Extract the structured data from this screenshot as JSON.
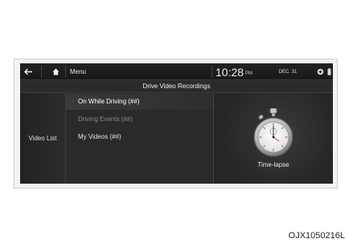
{
  "topbar": {
    "back_icon": "back-arrow-icon",
    "home_icon": "home-icon",
    "menu_label": "Menu",
    "time": "10:28",
    "ampm": "PM",
    "date": "DEC. 31",
    "status_icons": [
      "connectivity-status-icon",
      "battery-status-icon"
    ]
  },
  "header": {
    "title": "Drive Video Recordings"
  },
  "sidebar": {
    "label": "Video List"
  },
  "list": {
    "items": [
      {
        "label": "On While Driving (##)",
        "state": "selected"
      },
      {
        "label": "Driving Events (##)",
        "state": "disabled"
      },
      {
        "label": "My Videos (##)",
        "state": "enabled"
      }
    ]
  },
  "timelapse": {
    "icon": "stopwatch-icon",
    "label": "Time-lapse"
  },
  "caption": "OJX1050216L",
  "colors": {
    "screen_bg": "#262626",
    "text": "#e6e6e6",
    "disabled_text": "#8a8a8a"
  }
}
